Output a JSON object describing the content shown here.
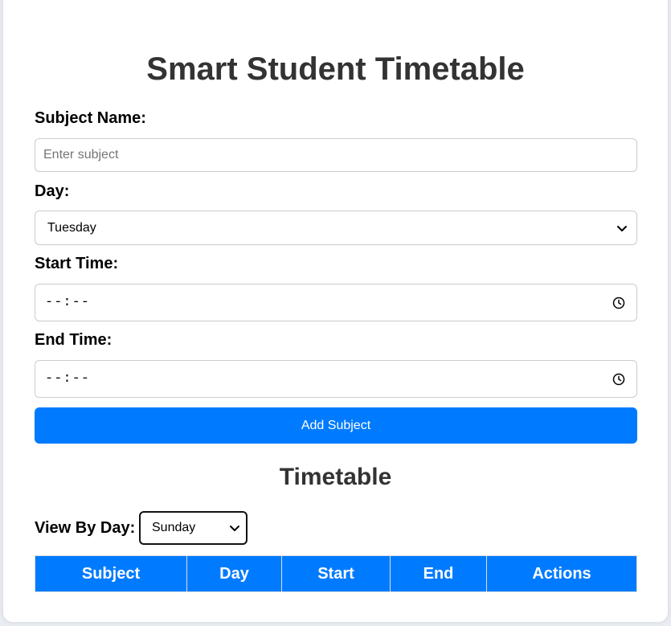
{
  "app": {
    "title": "Smart Student Timetable"
  },
  "form": {
    "subject": {
      "label": "Subject Name:",
      "placeholder": "Enter subject",
      "value": ""
    },
    "day": {
      "label": "Day:",
      "selected": "Tuesday"
    },
    "start_time": {
      "label": "Start Time:",
      "value": "--:--"
    },
    "end_time": {
      "label": "End Time:",
      "value": "--:--"
    },
    "add_button_label": "Add Subject"
  },
  "timetable": {
    "heading": "Timetable",
    "view_by_day_label": "View By Day:",
    "view_by_day_selected": "Sunday",
    "columns": [
      "Subject",
      "Day",
      "Start",
      "End",
      "Actions"
    ],
    "rows": []
  },
  "colors": {
    "accent": "#007bff",
    "heading": "#333333",
    "background": "#e9ecf1"
  },
  "icons": [
    "chevron-down-icon",
    "clock-icon"
  ]
}
